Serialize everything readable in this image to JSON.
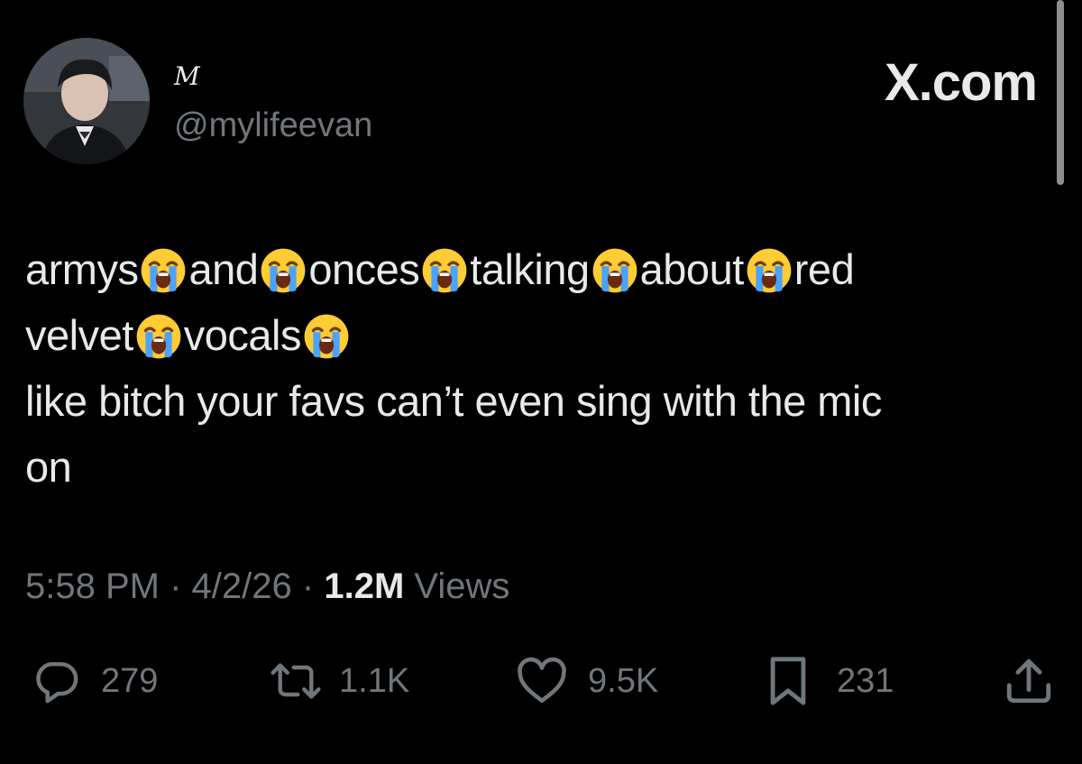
{
  "author": {
    "display_name": "M",
    "handle": "@mylifeevan"
  },
  "brand": "X.com",
  "tweet": {
    "lines": [
      [
        {
          "t": "armys"
        },
        {
          "e": "loudly-crying-face"
        },
        {
          "t": "and"
        },
        {
          "e": "loudly-crying-face"
        },
        {
          "t": "onces"
        },
        {
          "e": "loudly-crying-face"
        },
        {
          "t": "talking"
        },
        {
          "e": "loudly-crying-face"
        },
        {
          "t": "about"
        },
        {
          "e": "loudly-crying-face"
        },
        {
          "t": "red"
        }
      ],
      [
        {
          "t": "velvet"
        },
        {
          "e": "loudly-crying-face"
        },
        {
          "t": "vocals"
        },
        {
          "e": "loudly-crying-face"
        }
      ],
      [
        {
          "t": "like bitch your favs can’t even sing with the mic"
        }
      ],
      [
        {
          "t": "on"
        }
      ]
    ]
  },
  "meta": {
    "time": "5:58 PM",
    "date": "4/2/26",
    "separator": "·",
    "views_count": "1.2M",
    "views_label": "Views"
  },
  "actions": {
    "replies": "279",
    "reposts": "1.1K",
    "likes": "9.5K",
    "bookmarks": "231"
  },
  "colors": {
    "background": "#000000",
    "primary_text": "#e7e9ea",
    "secondary_text": "#71767b"
  }
}
